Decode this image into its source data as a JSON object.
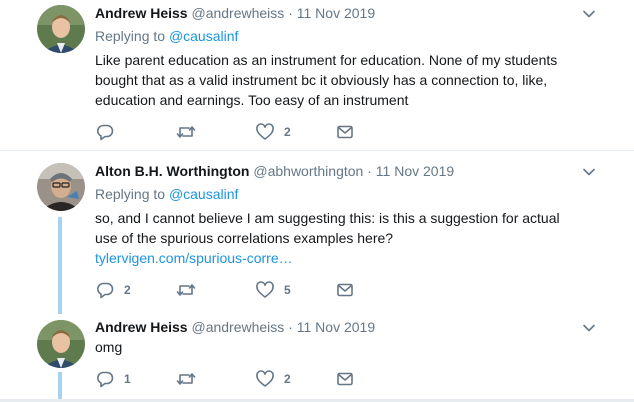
{
  "tweets": [
    {
      "name": "Andrew Heiss",
      "handle": "@andrewheiss",
      "separator": "·",
      "date": "11 Nov 2019",
      "replying_prefix": "Replying to",
      "replying_to": "@causalinf",
      "text": "Like parent education as an instrument for education. None of my students bought that as a valid instrument bc it obviously has a connection to, like, education and earnings. Too easy of an instrument",
      "reply_count": "",
      "retweet_count": "",
      "like_count": "2"
    },
    {
      "name": "Alton B.H. Worthington",
      "handle": "@abhworthington",
      "separator": "·",
      "date": "11 Nov 2019",
      "replying_prefix": "Replying to",
      "replying_to": "@causalinf",
      "text": "so, and I cannot believe I am suggesting this: is this a suggestion for actual use of the spurious correlations examples here?",
      "link": "tylervigen.com/spurious-corre…",
      "reply_count": "2",
      "retweet_count": "",
      "like_count": "5"
    },
    {
      "name": "Andrew Heiss",
      "handle": "@andrewheiss",
      "separator": "·",
      "date": "11 Nov 2019",
      "text": "omg",
      "reply_count": "1",
      "retweet_count": "",
      "like_count": "2"
    }
  ],
  "icons": {
    "reply": "reply-icon",
    "retweet": "retweet-icon",
    "like": "heart-icon",
    "dm": "envelope-icon",
    "menu": "chevron-down-icon"
  },
  "colors": {
    "link": "#1b95e0",
    "muted": "#657786",
    "thread_line": "#a7d3f0",
    "divider": "#e6ecf0"
  }
}
